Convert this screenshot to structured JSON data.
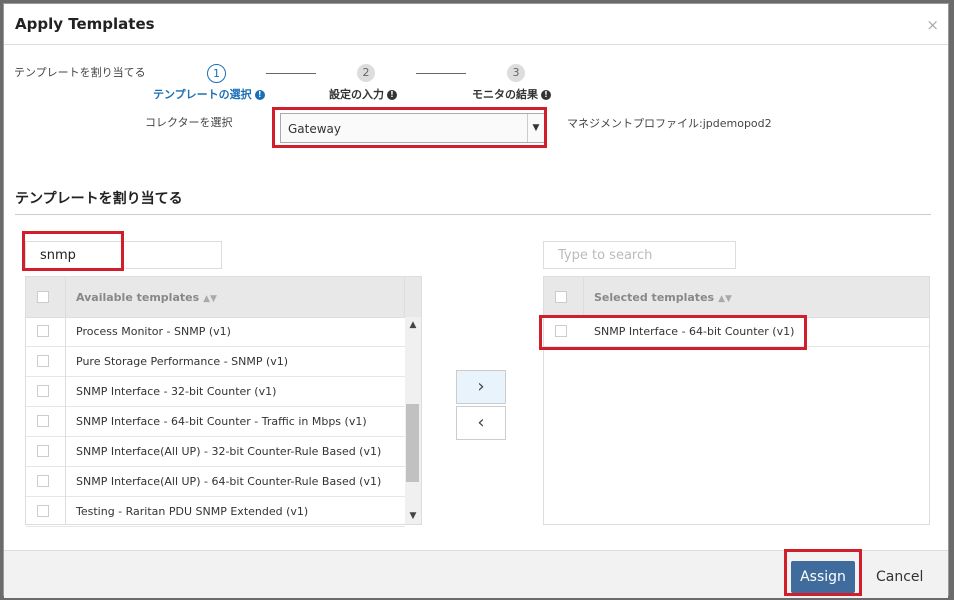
{
  "dialog": {
    "title": "Apply Templates",
    "close_glyph": "×"
  },
  "wizard": {
    "heading": "テンプレートを割り当てる",
    "steps": [
      {
        "number": "1",
        "label": "テンプレートの選択"
      },
      {
        "number": "2",
        "label": "設定の入力"
      },
      {
        "number": "3",
        "label": "モニタの結果"
      }
    ],
    "info_glyph": "!"
  },
  "collector": {
    "label": "コレクターを選択",
    "selected_value": "Gateway",
    "management_profile": "マネジメントプロファイル:jpdemopod2"
  },
  "assign_section": {
    "title": "テンプレートを割り当てる"
  },
  "available": {
    "search_value": "snmp",
    "header": "Available templates",
    "sort_glyph": "▲▼",
    "rows": [
      "Process Monitor - SNMP (v1)",
      "Pure Storage Performance - SNMP (v1)",
      "SNMP Interface - 32-bit Counter (v1)",
      "SNMP Interface - 64-bit Counter - Traffic in Mbps (v1)",
      "SNMP Interface(All UP) - 32-bit Counter-Rule Based (v1)",
      "SNMP Interface(All UP) - 64-bit Counter-Rule Based (v1)",
      "Testing - Raritan PDU SNMP Extended (v1)"
    ],
    "scroll_position": 0.72
  },
  "selected": {
    "search_placeholder": "Type to search",
    "header": "Selected templates",
    "rows": [
      "SNMP Interface - 64-bit Counter (v1)"
    ]
  },
  "transfer": {
    "move_right_glyph": "›",
    "move_left_glyph": "‹"
  },
  "footer": {
    "assign_label": "Assign",
    "cancel_label": "Cancel"
  },
  "colors": {
    "accent": "#1b6fb5",
    "highlight": "#d01f2b",
    "primary_button": "#3f6c9c"
  }
}
